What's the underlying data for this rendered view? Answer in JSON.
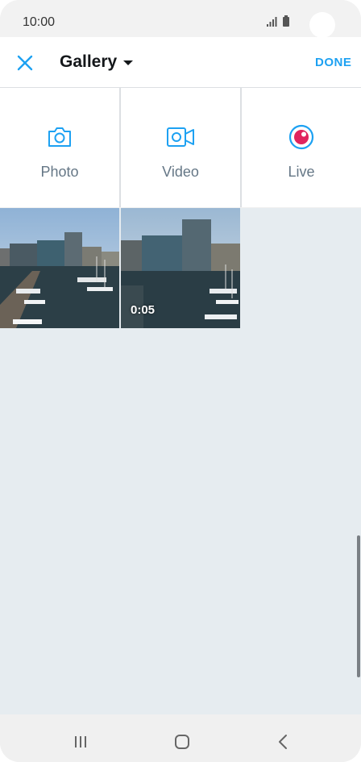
{
  "status_bar": {
    "time": "10:00"
  },
  "app_bar": {
    "title": "Gallery",
    "done_label": "DONE",
    "accent_color": "#1da1f2"
  },
  "actions": [
    {
      "label": "Photo",
      "icon": "camera-icon"
    },
    {
      "label": "Video",
      "icon": "video-camera-icon"
    },
    {
      "label": "Live",
      "icon": "live-broadcast-icon"
    }
  ],
  "media": [
    {
      "type": "photo",
      "subject": "harbor with buildings and boats"
    },
    {
      "type": "video",
      "duration": "0:05",
      "subject": "harbor with buildings and boats"
    }
  ],
  "nav_bar": {
    "recents": "recents-icon",
    "home": "home-icon",
    "back": "back-icon"
  }
}
